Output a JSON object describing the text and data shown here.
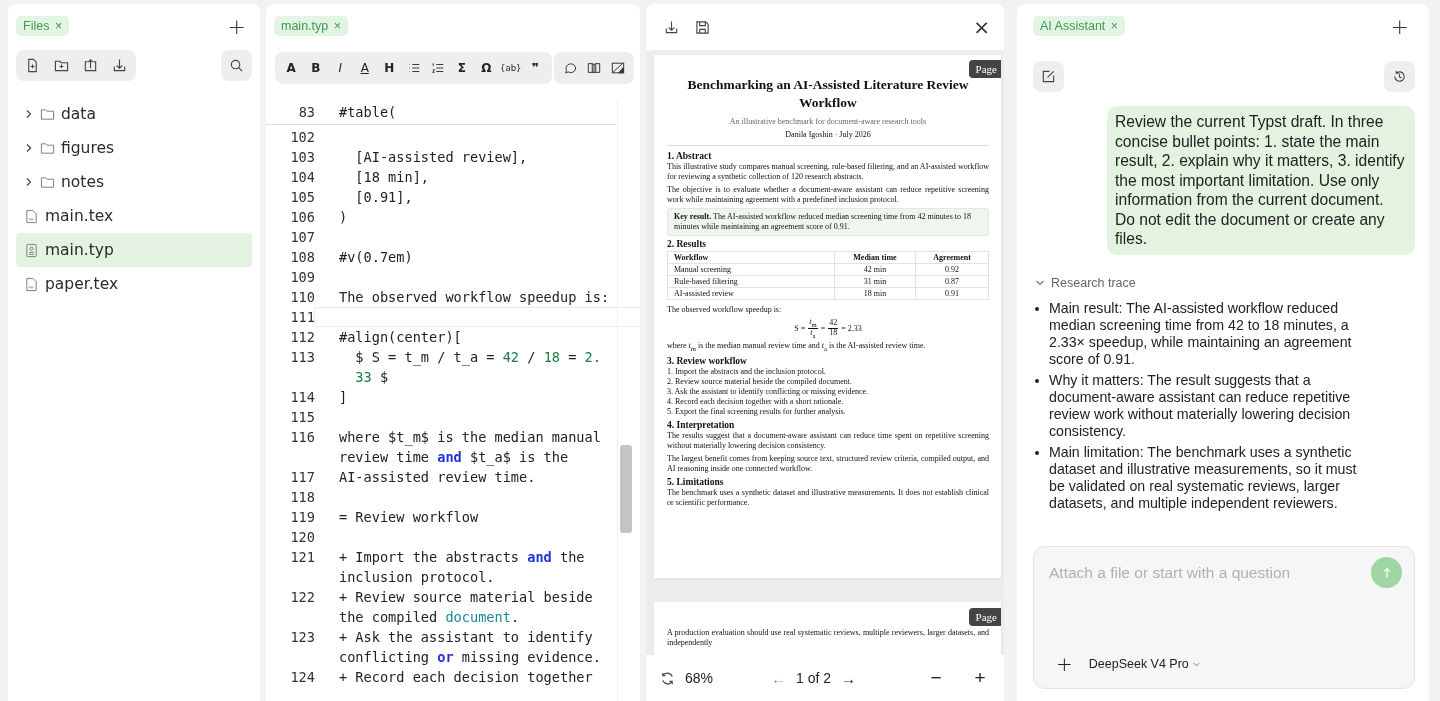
{
  "files_panel": {
    "tab": {
      "label": "Files",
      "close": "×"
    },
    "add": "+",
    "tree": [
      {
        "kind": "folder",
        "name": "data",
        "expanded": false,
        "selected": false
      },
      {
        "kind": "folder",
        "name": "figures",
        "expanded": false,
        "selected": false
      },
      {
        "kind": "folder",
        "name": "notes",
        "expanded": false,
        "selected": false
      },
      {
        "kind": "file",
        "name": "main.tex",
        "selected": false
      },
      {
        "kind": "typst",
        "name": "main.typ",
        "selected": true
      },
      {
        "kind": "file",
        "name": "paper.tex",
        "selected": false
      }
    ]
  },
  "editor": {
    "tab": {
      "label": "main.typ",
      "close": "×"
    },
    "toolbar": [
      [
        {
          "kind": "glyph",
          "label": "A"
        },
        {
          "kind": "glyph",
          "label": "B"
        },
        {
          "kind": "italic",
          "label": "I"
        },
        {
          "kind": "underline",
          "label": "A"
        },
        {
          "kind": "glyph",
          "label": "H"
        },
        {
          "kind": "bullet-list"
        },
        {
          "kind": "numbered-list"
        },
        {
          "kind": "glyph",
          "label": "Σ"
        },
        {
          "kind": "glyph",
          "label": "Ω"
        },
        {
          "kind": "small",
          "label": "{ab}"
        },
        {
          "kind": "glyph",
          "label": "❞"
        }
      ],
      [
        {
          "kind": "comment"
        },
        {
          "kind": "book"
        },
        {
          "kind": "image"
        }
      ]
    ],
    "sticky": {
      "number": "83",
      "segments": [
        {
          "kind": "plain",
          "text": "#table("
        }
      ]
    },
    "lines": [
      {
        "number": "102",
        "current": false
      },
      {
        "number": "103",
        "current": false,
        "segments": [
          {
            "kind": "plain",
            "text": "  [AI-assisted review],"
          }
        ]
      },
      {
        "number": "104",
        "current": false,
        "segments": [
          {
            "kind": "plain",
            "text": "  [18 min],"
          }
        ]
      },
      {
        "number": "105",
        "current": false,
        "segments": [
          {
            "kind": "plain",
            "text": "  [0.91],"
          }
        ]
      },
      {
        "number": "106",
        "current": false,
        "segments": [
          {
            "kind": "plain",
            "text": ")"
          }
        ]
      },
      {
        "number": "107",
        "current": false
      },
      {
        "number": "108",
        "current": false,
        "segments": [
          {
            "kind": "plain",
            "text": "#v(0.7em)"
          }
        ]
      },
      {
        "number": "109",
        "current": false
      },
      {
        "number": "110",
        "current": false,
        "segments": [
          {
            "kind": "plain",
            "text": "The observed workflow speedup is:"
          }
        ]
      },
      {
        "number": "111",
        "current": true
      },
      {
        "number": "112",
        "current": false,
        "segments": [
          {
            "kind": "plain",
            "text": "#align(center)["
          }
        ]
      },
      {
        "number": "113",
        "current": false,
        "segments": [
          {
            "kind": "plain",
            "text": "  $ S = t_m / t_a = "
          },
          {
            "kind": "number",
            "text": "42"
          },
          {
            "kind": "plain",
            "text": " / "
          },
          {
            "kind": "number",
            "text": "18"
          },
          {
            "kind": "plain",
            "text": " = "
          },
          {
            "kind": "number",
            "text": "2."
          }
        ]
      },
      {
        "current": false,
        "segments": [
          {
            "kind": "number",
            "text": "  33"
          },
          {
            "kind": "plain",
            "text": " $"
          }
        ]
      },
      {
        "number": "114",
        "current": false,
        "segments": [
          {
            "kind": "plain",
            "text": "]"
          }
        ]
      },
      {
        "number": "115",
        "current": false
      },
      {
        "number": "116",
        "current": false,
        "segments": [
          {
            "kind": "plain",
            "text": "where $t_m$ is the median manual"
          }
        ]
      },
      {
        "current": false,
        "segments": [
          {
            "kind": "plain",
            "text": "review time "
          },
          {
            "kind": "keyword",
            "text": "and"
          },
          {
            "kind": "plain",
            "text": " $t_a$ is the"
          }
        ]
      },
      {
        "number": "117",
        "current": false,
        "segments": [
          {
            "kind": "plain",
            "text": "AI-assisted review time."
          }
        ]
      },
      {
        "number": "118",
        "current": false
      },
      {
        "number": "119",
        "current": false,
        "segments": [
          {
            "kind": "plain",
            "text": "= Review workflow"
          }
        ]
      },
      {
        "number": "120",
        "current": false
      },
      {
        "number": "121",
        "current": false,
        "segments": [
          {
            "kind": "plain",
            "text": "+ Import the abstracts "
          },
          {
            "kind": "keyword",
            "text": "and"
          },
          {
            "kind": "plain",
            "text": " the"
          }
        ]
      },
      {
        "current": false,
        "segments": [
          {
            "kind": "plain",
            "text": "inclusion protocol."
          }
        ]
      },
      {
        "number": "122",
        "current": false,
        "segments": [
          {
            "kind": "plain",
            "text": "+ Review source material beside"
          }
        ]
      },
      {
        "current": false,
        "segments": [
          {
            "kind": "plain",
            "text": "the compiled "
          },
          {
            "kind": "link",
            "text": "document"
          },
          {
            "kind": "plain",
            "text": "."
          }
        ]
      },
      {
        "number": "123",
        "current": false,
        "segments": [
          {
            "kind": "plain",
            "text": "+ Ask the assistant to identify"
          }
        ]
      },
      {
        "current": false,
        "segments": [
          {
            "kind": "plain",
            "text": "conflicting "
          },
          {
            "kind": "keyword",
            "text": "or"
          },
          {
            "kind": "plain",
            "text": " missing evidence."
          }
        ]
      },
      {
        "number": "124",
        "current": false,
        "segments": [
          {
            "kind": "plain",
            "text": "+ Record each decision together"
          }
        ]
      }
    ]
  },
  "preview": {
    "close": "×",
    "pages": [
      {
        "badge": "Page",
        "title": "Benchmarking an AI-Assisted Literature Review Workflow",
        "subtitle": "An illustrative benchmark for document-aware research tools",
        "author": "Danila Igoshin · July 2026",
        "sections": [
          {
            "heading": "1. Abstract",
            "blocks": [
              {
                "kind": "paragraph",
                "text": "This illustrative study compares manual screening, rule-based filtering, and an AI-assisted workflow for reviewing a synthetic collection of 120 research abstracts."
              },
              {
                "kind": "paragraph",
                "text": "The objective is to evaluate whether a document-aware assistant can reduce repetitive screening work while maintaining agreement with a predefined inclusion protocol."
              },
              {
                "kind": "callout",
                "text": "**Key result.** The AI-assisted workflow reduced median screening time from 42 minutes to 18 minutes while maintaining an agreement score of 0.91."
              }
            ]
          },
          {
            "heading": "2. Results",
            "blocks": [
              {
                "kind": "table",
                "columns": [
                  "Workflow",
                  "Median time",
                  "Agreement"
                ],
                "rows": [
                  [
                    "Manual screening",
                    "42 min",
                    "0.92"
                  ],
                  [
                    "Rule-based filtering",
                    "31 min",
                    "0.87"
                  ],
                  [
                    "AI-assisted review",
                    "18 min",
                    "0.91"
                  ]
                ]
              },
              {
                "kind": "paragraph",
                "text": "The observed workflow speedup is:"
              },
              {
                "kind": "formula",
                "parts": [
                  {
                    "kind": "text",
                    "text": "S ="
                  },
                  {
                    "kind": "fraction",
                    "numerator": "*t*$_{m}$",
                    "denominator": "*t*$_{a}$"
                  },
                  {
                    "kind": "text",
                    "text": "="
                  },
                  {
                    "kind": "fraction",
                    "numerator": "42",
                    "denominator": "18"
                  },
                  {
                    "kind": "text",
                    "text": "= 2.33"
                  }
                ]
              },
              {
                "kind": "paragraph",
                "text": "where *t*$_{m}$ is the median manual review time and *t*$_{a}$ is the AI-assisted review time."
              }
            ]
          },
          {
            "heading": "3. Review workflow",
            "blocks": [
              {
                "kind": "list",
                "items": [
                  "1. Import the abstracts and the inclusion protocol.",
                  "2. Review source material beside the compiled document.",
                  "3. Ask the assistant to identify conflicting or missing evidence.",
                  "4. Record each decision together with a short rationale.",
                  "5. Export the final screening results for further analysis."
                ]
              }
            ]
          },
          {
            "heading": "4. Interpretation",
            "blocks": [
              {
                "kind": "paragraph",
                "text": "The results suggest that a document-aware assistant can reduce time spent on repetitive screening without materially lowering decision consistency."
              },
              {
                "kind": "paragraph",
                "text": "The largest benefit comes from keeping source text, structured review criteria, compiled output, and AI reasoning inside one connected workflow."
              }
            ]
          },
          {
            "heading": "5. Limitations",
            "blocks": [
              {
                "kind": "paragraph",
                "text": "The benchmark uses a synthetic dataset and illustrative measurements. It does not establish clinical or scientific performance."
              }
            ]
          }
        ]
      },
      {
        "badge": "Page",
        "sections": [
          {
            "blocks": [
              {
                "kind": "paragraph",
                "text": "A production evaluation should use real systematic reviews, multiple reviewers, larger datasets, and independently"
              }
            ]
          }
        ]
      }
    ],
    "zoom": "68%",
    "prev": "←",
    "page_indicator": "1 of 2",
    "next": "→",
    "zoom_out": "−",
    "zoom_in": "+"
  },
  "assistant": {
    "tab": {
      "label": "AI Assistant",
      "close": "×"
    },
    "add": "+",
    "user_message": "Review the current Typst draft. In three concise bullet points: 1. state the main result, 2. explain why it matters, 3. identify the most important limitation. Use only information from the current document. Do not edit the document or create any files.",
    "trace": {
      "label": "Research trace",
      "expanded": true
    },
    "bullets": [
      "Main result: The AI-assisted workflow reduced median screening time from 42 to 18 minutes, a 2.33× speedup, while maintaining an agreement score of 0.91.",
      "Why it matters: The result suggests that a document-aware assistant can reduce repetitive review work without materially lowering decision consistency.",
      "Main limitation: The benchmark uses a synthetic dataset and illustrative measurements, so it must be validated on real systematic reviews, larger datasets, and multiple independent reviewers."
    ],
    "input": {
      "placeholder": "Attach a file or start with a question"
    },
    "attach": "+",
    "model": "DeepSeek V4 Pro"
  }
}
